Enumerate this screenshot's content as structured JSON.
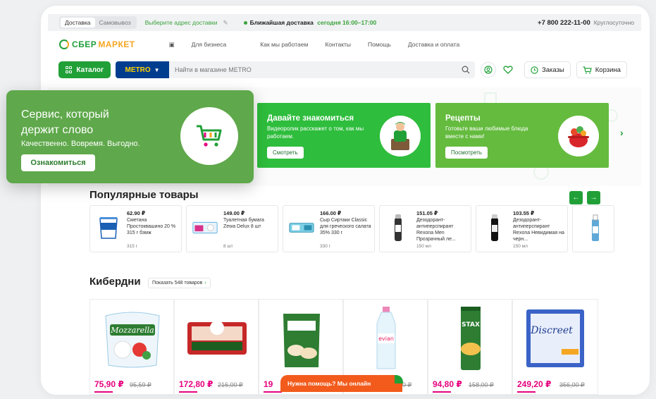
{
  "topbar": {
    "delivery_tab": "Доставка",
    "pickup_tab": "Самовывоз",
    "address_link": "Выберите адрес доставки",
    "nearest_label": "Ближайшая доставка",
    "nearest_time": "сегодня 16:00–17:00",
    "phone": "+7 800 222-11-00",
    "around_clock": "Круглосуточно"
  },
  "logo": {
    "part1": "СБЕР",
    "part2": "МАРКЕТ"
  },
  "nav": [
    "Для бизнеса",
    "Как мы работаем",
    "Контакты",
    "Помощь",
    "Доставка и оплата"
  ],
  "search": {
    "catalog_label": "Каталог",
    "store": "METRO",
    "placeholder": "Найти в магазине METRO",
    "orders_label": "Заказы",
    "cart_label": "Корзина"
  },
  "promo": {
    "title": "Сервис, который держит слово",
    "subtitle": "Качественно. Вовремя. Выгодно.",
    "button": "Ознакомиться"
  },
  "banners": [
    {
      "title": "Давайте знакомиться",
      "text": "Видеоролик расскажет о том, как мы работаем.",
      "button": "Смотреть"
    },
    {
      "title": "Рецепты",
      "text": "Готовьте ваши любимые блюда вместе с нами!",
      "button": "Посмотреть"
    }
  ],
  "popular": {
    "title": "Популярные товары",
    "items": [
      {
        "price": "62.90 ₽",
        "name": "Сметана Простоквашино 20 % 315 г бзмж",
        "qty": "315 г"
      },
      {
        "price": "149.00 ₽",
        "name": "Туалетная бумага Zewa Delux 8 шт",
        "qty": "8 шт"
      },
      {
        "price": "166.00 ₽",
        "name": "Сыр Сиртаки Classic для греческого салата 35% 330 г",
        "qty": "330 г"
      },
      {
        "price": "151.05 ₽",
        "name": "Дезодорант-антиперспирант Rexona Men Прозрачный ле...",
        "qty": "150 мл"
      },
      {
        "price": "103.55 ₽",
        "name": "Дезодорант-антиперспирант Rexona Невидимая на черн...",
        "qty": "150 мл"
      }
    ]
  },
  "kiberdni": {
    "title": "Кибердни",
    "show_button": "Показать 548 товаров",
    "items": [
      {
        "price": "75,90 ₽",
        "old": "95,59 ₽"
      },
      {
        "price": "172,80 ₽",
        "old": "216,00 ₽"
      },
      {
        "price": "19",
        "old": ""
      },
      {
        "price": "",
        "old": "00 ₽"
      },
      {
        "price": "94,80 ₽",
        "old": "158,00 ₽"
      },
      {
        "price": "249,20 ₽",
        "old": "356,00 ₽"
      }
    ]
  },
  "help_chat": "Нужна помощь? Мы онлайн",
  "colors": {
    "brand_green": "#21a038",
    "accent_pink": "#e6007e",
    "help_orange": "#f25b1c",
    "metro_blue": "#003d8f"
  }
}
